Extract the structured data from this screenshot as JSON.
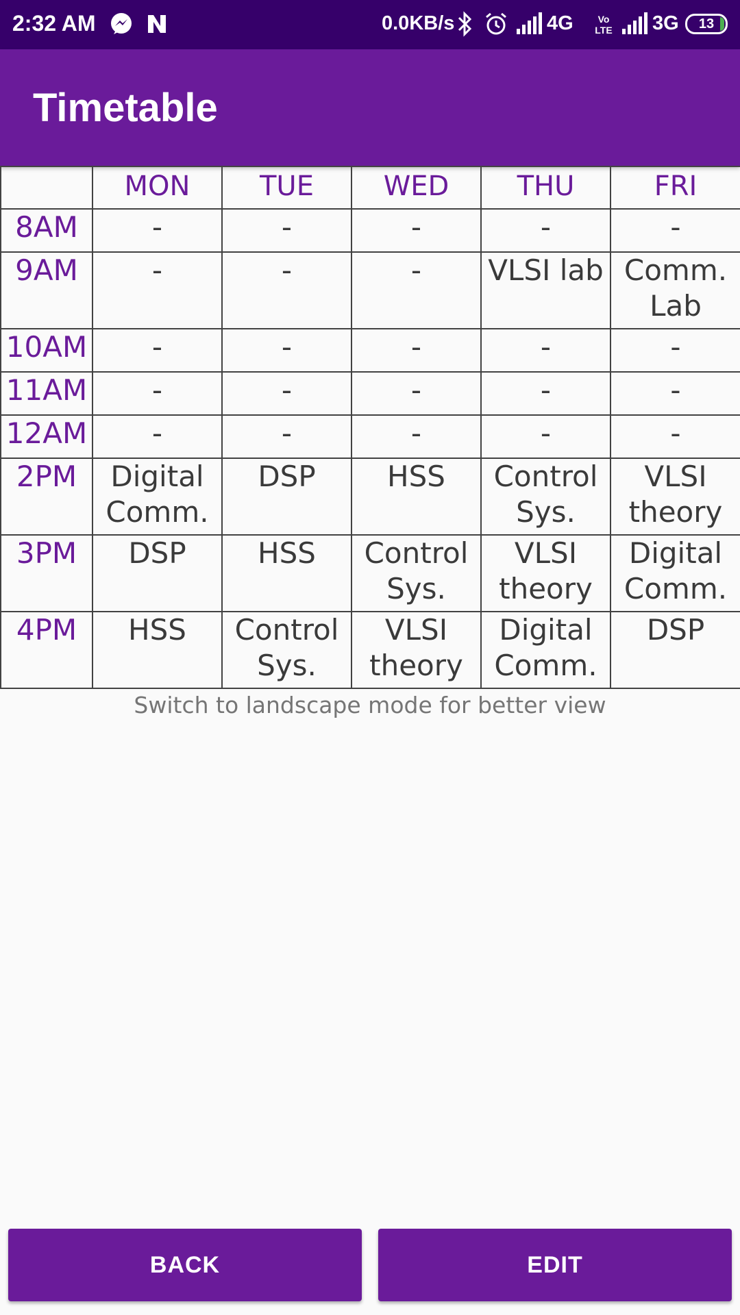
{
  "status_bar": {
    "time": "2:32 AM",
    "network_speed": "0.0KB/s",
    "network_type_1": "4G",
    "network_type_2": "3G",
    "battery_level": "13",
    "icons": [
      "messenger-icon",
      "notification-n-icon",
      "bluetooth-icon",
      "alarm-icon",
      "signal-icon",
      "volte-icon",
      "battery-icon"
    ]
  },
  "app_bar": {
    "title": "Timetable"
  },
  "timetable": {
    "days": [
      "MON",
      "TUE",
      "WED",
      "THU",
      "FRI"
    ],
    "rows": [
      {
        "time": "8AM",
        "cells": [
          "-",
          "-",
          "-",
          "-",
          "-"
        ]
      },
      {
        "time": "9AM",
        "cells": [
          "-",
          "-",
          "-",
          "VLSI lab",
          "Comm. Lab"
        ]
      },
      {
        "time": "10AM",
        "cells": [
          "-",
          "-",
          "-",
          "-",
          "-"
        ]
      },
      {
        "time": "11AM",
        "cells": [
          "-",
          "-",
          "-",
          "-",
          "-"
        ]
      },
      {
        "time": "12AM",
        "cells": [
          "-",
          "-",
          "-",
          "-",
          "-"
        ]
      },
      {
        "time": "2PM",
        "cells": [
          "Digital Comm.",
          "DSP",
          "HSS",
          "Control Sys.",
          "VLSI theory"
        ]
      },
      {
        "time": "3PM",
        "cells": [
          "DSP",
          "HSS",
          "Control Sys.",
          "VLSI theory",
          "Digital Comm."
        ]
      },
      {
        "time": "4PM",
        "cells": [
          "HSS",
          "Control Sys.",
          "VLSI theory",
          "Digital Comm.",
          "DSP"
        ]
      }
    ]
  },
  "note": "Switch to landscape mode for better view",
  "buttons": {
    "back": "BACK",
    "edit": "EDIT"
  },
  "colors": {
    "status_bar": "#36006a",
    "primary": "#6a1b9a",
    "background": "#fafafa"
  }
}
